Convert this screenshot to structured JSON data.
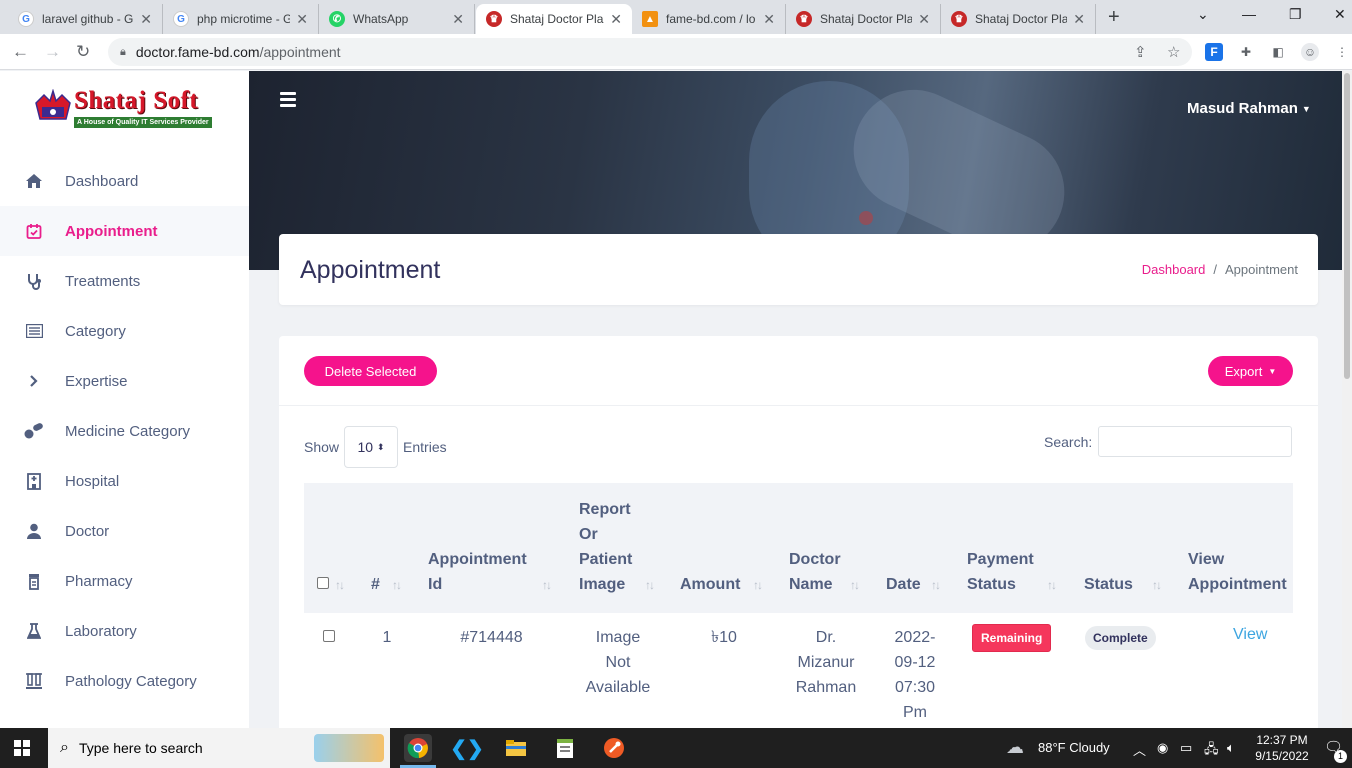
{
  "browser": {
    "tabs": [
      {
        "title": "laravel github - G",
        "fav_letter": "G",
        "fav_color": "#4285f4"
      },
      {
        "title": "php microtime - G",
        "fav_letter": "G",
        "fav_color": "#4285f4"
      },
      {
        "title": "WhatsApp",
        "fav_letter": "W",
        "fav_color": "#25d366"
      },
      {
        "title": "Shataj Doctor Pla",
        "fav_letter": "S",
        "fav_color": "#c62828"
      },
      {
        "title": "fame-bd.com / lo",
        "fav_letter": "P",
        "fav_color": "#f29111"
      },
      {
        "title": "Shataj Doctor Pla",
        "fav_letter": "S",
        "fav_color": "#c62828"
      },
      {
        "title": "Shataj Doctor Pla",
        "fav_letter": "S",
        "fav_color": "#c62828"
      }
    ],
    "url_host": "doctor.fame-bd.com",
    "url_path": "/appointment"
  },
  "sidebar": {
    "logo_brand": "Shataj Soft",
    "logo_tagline": "A House of Quality IT Services Provider",
    "items": [
      {
        "label": "Dashboard",
        "icon": "home-icon"
      },
      {
        "label": "Appointment",
        "icon": "calendar-check-icon",
        "active": true
      },
      {
        "label": "Treatments",
        "icon": "stethoscope-icon"
      },
      {
        "label": "Category",
        "icon": "list-icon"
      },
      {
        "label": "Expertise",
        "icon": "chevron-right-icon"
      },
      {
        "label": "Medicine Category",
        "icon": "pills-icon"
      },
      {
        "label": "Hospital",
        "icon": "hospital-icon"
      },
      {
        "label": "Doctor",
        "icon": "user-doctor-icon"
      },
      {
        "label": "Pharmacy",
        "icon": "pharmacy-icon"
      },
      {
        "label": "Laboratory",
        "icon": "flask-icon"
      },
      {
        "label": "Pathology Category",
        "icon": "vials-icon"
      }
    ]
  },
  "header": {
    "user_name": "Masud Rahman"
  },
  "page": {
    "title": "Appointment",
    "breadcrumb": {
      "home": "Dashboard",
      "current": "Appointment"
    }
  },
  "toolbar": {
    "delete_label": "Delete Selected",
    "export_label": "Export"
  },
  "table_controls": {
    "show_label": "Show",
    "entries_value": "10",
    "entries_label": "Entries",
    "search_label": "Search:"
  },
  "table": {
    "columns": {
      "num": "#",
      "appointment_id": [
        "Appointment",
        "Id"
      ],
      "report": [
        "Report",
        "Or",
        "Patient",
        "Image"
      ],
      "amount": "Amount",
      "doctor": [
        "Doctor",
        "Name"
      ],
      "date": "Date",
      "payment": [
        "Payment",
        "Status"
      ],
      "status": "Status",
      "view": [
        "View",
        "Appointment"
      ]
    },
    "rows": [
      {
        "num": "1",
        "appointment_id": "#714448",
        "report": [
          "Image",
          "Not",
          "Available"
        ],
        "amount": "৳10",
        "doctor": [
          "Dr.",
          "Mizanur",
          "Rahman"
        ],
        "date": [
          "2022-",
          "09-12"
        ],
        "time": [
          "07:30",
          "Pm"
        ],
        "payment_status": "Remaining",
        "status": "Complete",
        "view_label": "View"
      }
    ]
  },
  "taskbar": {
    "search_placeholder": "Type here to search",
    "weather": "88°F  Cloudy",
    "time": "12:37 PM",
    "date": "9/15/2022",
    "notification_count": "1"
  },
  "colors": {
    "accent": "#e91e8c",
    "danger": "#f5365c",
    "link": "#3da5e0"
  }
}
